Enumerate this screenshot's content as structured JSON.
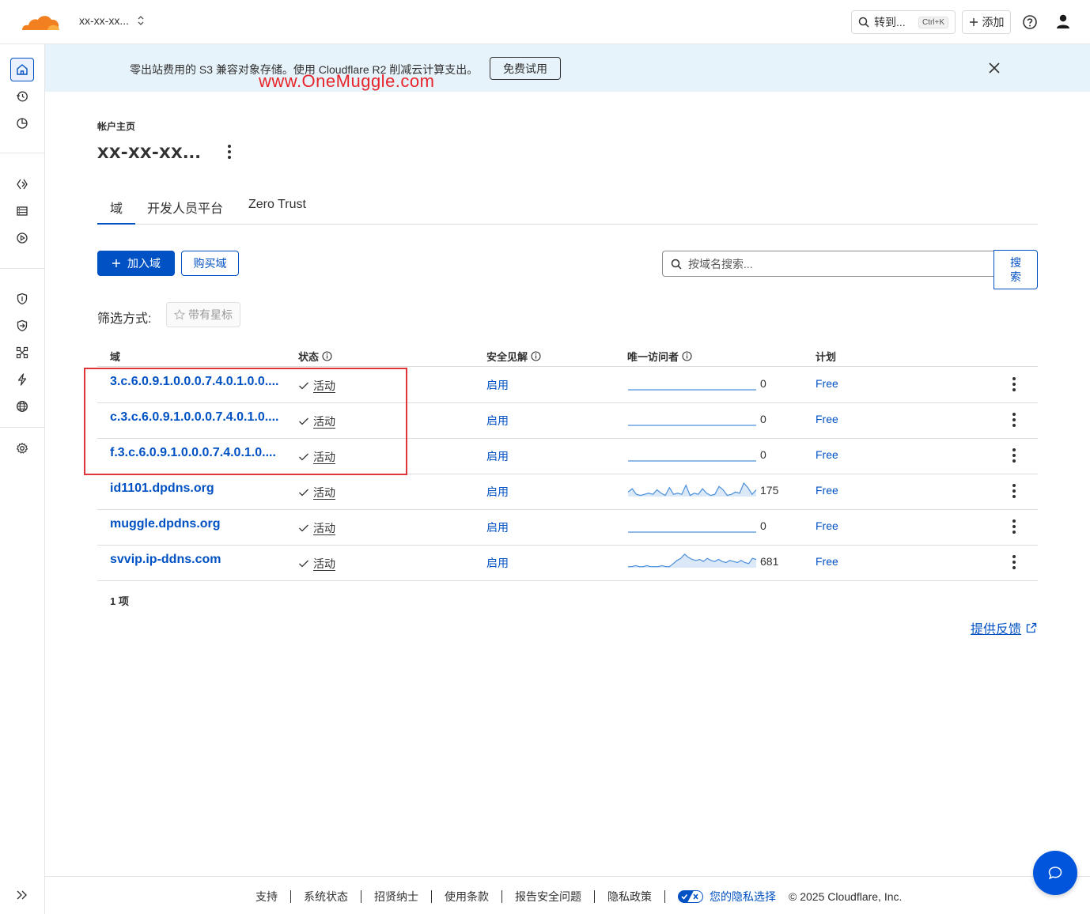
{
  "header": {
    "account_name": "xx-xx-xx...",
    "goto_label": "转到...",
    "goto_shortcut": "Ctrl+K",
    "add_label": "添加"
  },
  "banner": {
    "text": "零出站费用的 S3 兼容对象存储。使用 Cloudflare R2 削减云计算支出。",
    "button": "免费试用",
    "watermark": "www.OneMuggle.com"
  },
  "page": {
    "breadcrumb": "帐户主页",
    "title": "xx-xx-xx..."
  },
  "tabs": [
    {
      "label": "域"
    },
    {
      "label": "开发人员平台"
    },
    {
      "label": "Zero Trust"
    }
  ],
  "actions": {
    "add_domain": "加入域",
    "buy_domain": "购买域",
    "search_placeholder": "按域名搜索...",
    "search_button": "搜索"
  },
  "filter": {
    "label": "筛选方式:",
    "starred": "带有星标"
  },
  "table": {
    "headers": {
      "domain": "域",
      "status": "状态",
      "insight": "安全见解",
      "visitors": "唯一访问者",
      "plan": "计划"
    },
    "rows": [
      {
        "domain": "3.c.6.0.9.1.0.0.0.7.4.0.1.0.0....",
        "status": "活动",
        "insight": "启用",
        "visitors": "0",
        "plan": "Free",
        "spark": [
          0,
          0,
          0,
          0,
          0,
          0,
          0,
          0,
          0,
          0,
          0,
          0,
          0,
          0,
          0,
          0,
          0,
          0,
          0,
          0,
          0,
          0,
          0,
          0
        ]
      },
      {
        "domain": "c.3.c.6.0.9.1.0.0.0.7.4.0.1.0....",
        "status": "活动",
        "insight": "启用",
        "visitors": "0",
        "plan": "Free",
        "spark": [
          0,
          0,
          0,
          0,
          0,
          0,
          0,
          0,
          0,
          0,
          0,
          0,
          0,
          0,
          0,
          0,
          0,
          0,
          0,
          0,
          0,
          0,
          0,
          0
        ]
      },
      {
        "domain": "f.3.c.6.0.9.1.0.0.0.7.4.0.1.0....",
        "status": "活动",
        "insight": "启用",
        "visitors": "0",
        "plan": "Free",
        "spark": [
          0,
          0,
          0,
          0,
          0,
          0,
          0,
          0,
          0,
          0,
          0,
          0,
          0,
          0,
          0,
          0,
          0,
          0,
          0,
          0,
          0,
          0,
          0,
          0
        ]
      },
      {
        "domain": "id1101.dpdns.org",
        "status": "活动",
        "insight": "启用",
        "visitors": "175",
        "plan": "Free",
        "spark": [
          4,
          7,
          2,
          1,
          2,
          3,
          2,
          6,
          3,
          1,
          8,
          2,
          3,
          2,
          10,
          1,
          3,
          2,
          7,
          3,
          1,
          2,
          9,
          6,
          1,
          2,
          4,
          3,
          12,
          8,
          2,
          6
        ]
      },
      {
        "domain": "muggle.dpdns.org",
        "status": "活动",
        "insight": "启用",
        "visitors": "0",
        "plan": "Free",
        "spark": [
          0,
          0,
          0,
          0,
          0,
          0,
          0,
          0,
          0,
          0,
          0,
          0,
          0,
          0,
          0,
          0,
          0,
          0,
          0,
          0,
          0,
          0,
          0,
          0
        ]
      },
      {
        "domain": "svvip.ip-ddns.com",
        "status": "活动",
        "insight": "启用",
        "visitors": "681",
        "plan": "Free",
        "spark": [
          1,
          1,
          2,
          1,
          1,
          2,
          1,
          1,
          1,
          2,
          1,
          1,
          4,
          7,
          9,
          13,
          10,
          8,
          7,
          8,
          6,
          9,
          7,
          6,
          8,
          6,
          5,
          7,
          6,
          5,
          7,
          5,
          4,
          9,
          8
        ]
      }
    ]
  },
  "count_text": "1 项",
  "feedback": "提供反馈",
  "footer": {
    "links": [
      "支持",
      "系统状态",
      "招贤纳士",
      "使用条款",
      "报告安全问题",
      "隐私政策"
    ],
    "privacy_choice": "您的隐私选择",
    "copyright": "© 2025 Cloudflare, Inc."
  },
  "colors": {
    "brand_blue": "#0051c3",
    "cloudflare_orange": "#f38020",
    "highlight_red": "#e0333a"
  }
}
